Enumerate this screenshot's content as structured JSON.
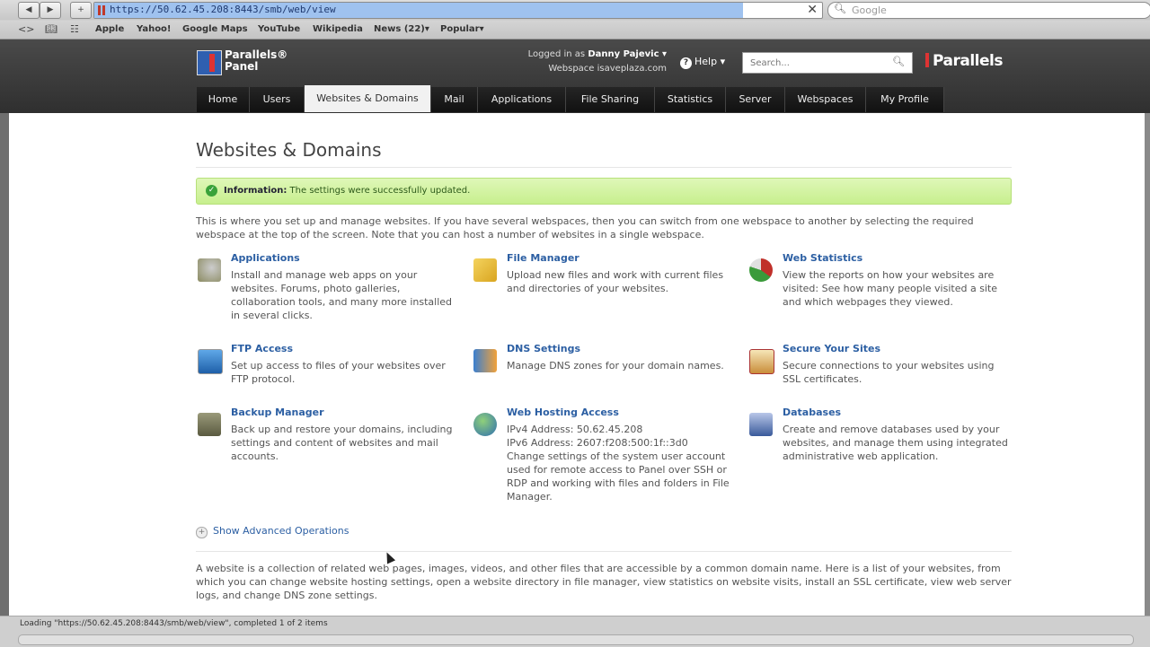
{
  "browser": {
    "url": "https://50.62.45.208:8443/smb/web/view",
    "search_placeholder": "Google",
    "bookmarks": [
      "Apple",
      "Yahoo!",
      "Google Maps",
      "YouTube",
      "Wikipedia",
      "News (22)▾",
      "Popular▾"
    ],
    "status": "Loading \"https://50.62.45.208:8443/smb/web/view\", completed 1 of 2 items"
  },
  "header": {
    "logo_line1": "Parallels®",
    "logo_line2": "Panel",
    "logged_in_label": "Logged in as",
    "user": "Danny Pajevic ▾",
    "webspace_label": "Webspace",
    "webspace": "isaveplaza.com",
    "help": "Help ▾",
    "search_placeholder": "Search...",
    "brand": "Parallels"
  },
  "tabs": [
    "Home",
    "Users",
    "Websites & Domains",
    "Mail",
    "Applications",
    "File Sharing",
    "Statistics",
    "Server",
    "Webspaces",
    "My Profile"
  ],
  "main": {
    "title": "Websites & Domains",
    "info_label": "Information:",
    "info_text": "The settings were successfully updated.",
    "intro": "This is where you set up and manage websites. If you have several webspaces, then you can switch from one webspace to another by selecting the required webspace at the top of the screen. Note that you can host a number of websites in a single webspace.",
    "features": [
      {
        "title": "Applications",
        "desc": "Install and manage web apps on your websites. Forums, photo galleries, collaboration tools, and many more installed in several clicks."
      },
      {
        "title": "File Manager",
        "desc": "Upload new files and work with current files and directories of your websites."
      },
      {
        "title": "Web Statistics",
        "desc": "View the reports on how your websites are visited: See how many people visited a site and which webpages they viewed."
      },
      {
        "title": "FTP Access",
        "desc": "Set up access to files of your websites over FTP protocol."
      },
      {
        "title": "DNS Settings",
        "desc": "Manage DNS zones for your domain names."
      },
      {
        "title": "Secure Your Sites",
        "desc": "Secure connections to your websites using SSL certificates."
      },
      {
        "title": "Backup Manager",
        "desc": "Back up and restore your domains, including settings and content of websites and mail accounts."
      },
      {
        "title": "Web Hosting Access",
        "desc": "IPv4 Address: 50.62.45.208\nIPv6 Address: 2607:f208:500:1f::3d0\nChange settings of the system user account used for remote access to Panel over SSH or RDP and working with files and folders in File Manager."
      },
      {
        "title": "Databases",
        "desc": "Create and remove databases used by your websites, and manage them using integrated administrative web application."
      }
    ],
    "advanced": "Show Advanced Operations",
    "outro": "A website is a collection of related web pages, images, videos, and other files that are accessible by a common domain name. Here is a list of your websites, from which you can change website hosting settings, open a website directory in file manager, view statistics on website visits, install an SSL certificate, view web server logs, and change DNS zone settings."
  }
}
